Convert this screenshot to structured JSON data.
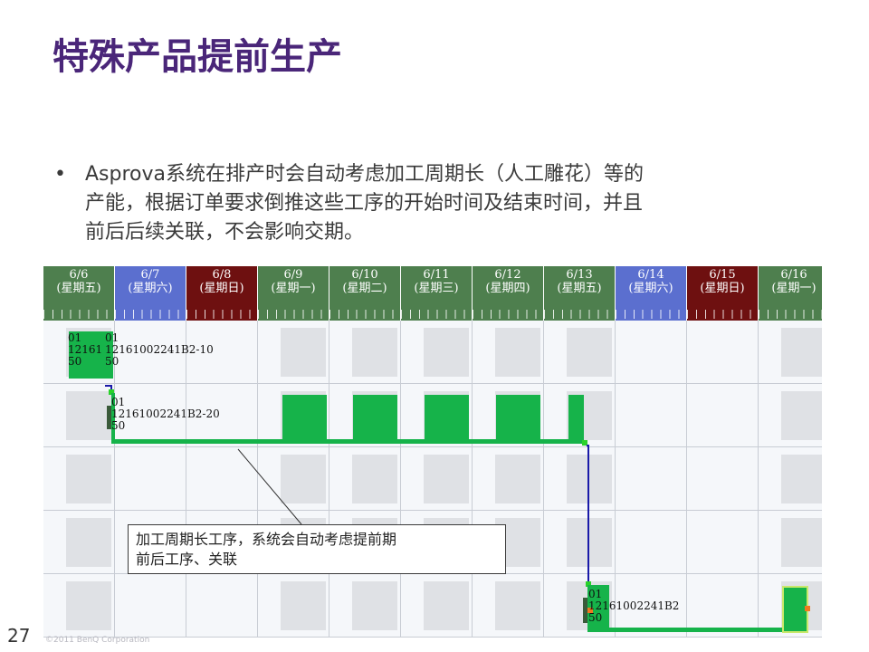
{
  "slide": {
    "title": "特殊产品提前生产",
    "bullet_symbol": "•",
    "bullet_lines": [
      "Asprova系统在排产时会自动考虑加工周期长（人工雕花）等的",
      "产能，根据订单要求倒推这些工序的开始时间及结束时间，并且",
      "前后后续关联，不会影响交期。"
    ],
    "page_number": "27",
    "copyright": "©2011 BenQ Corporation"
  },
  "gantt": {
    "days": [
      {
        "date": "6/6",
        "weekday": "(星期五)",
        "color": "#4e7f4e"
      },
      {
        "date": "6/7",
        "weekday": "(星期六)",
        "color": "#5b6fcf"
      },
      {
        "date": "6/8",
        "weekday": "(星期日)",
        "color": "#6e1010"
      },
      {
        "date": "6/9",
        "weekday": "(星期一)",
        "color": "#4e7f4e"
      },
      {
        "date": "6/10",
        "weekday": "(星期二)",
        "color": "#4e7f4e"
      },
      {
        "date": "6/11",
        "weekday": "(星期三)",
        "color": "#4e7f4e"
      },
      {
        "date": "6/12",
        "weekday": "(星期四)",
        "color": "#4e7f4e"
      },
      {
        "date": "6/13",
        "weekday": "(星期五)",
        "color": "#4e7f4e"
      },
      {
        "date": "6/14",
        "weekday": "(星期六)",
        "color": "#5b6fcf"
      },
      {
        "date": "6/15",
        "weekday": "(星期日)",
        "color": "#6e1010"
      },
      {
        "date": "6/16",
        "weekday": "(星期一)",
        "color": "#4e7f4e"
      }
    ],
    "job_labels": {
      "job1_left": [
        "01",
        "12161",
        "50"
      ],
      "job1_right": [
        "01",
        "12161002241B2-10",
        "50"
      ],
      "job2": [
        "01",
        "12161002241B2-20",
        "50"
      ],
      "job3": [
        "01",
        "12161002241B2",
        "50"
      ]
    },
    "colors": {
      "task_green": "#16b34a",
      "link_blue": "#1a1aa8",
      "marker_orange": "#f07820",
      "marker_green": "#2ad22a"
    },
    "callout_lines": [
      "加工周期长工序，系统会自动考虑提前期",
      "前后工序、关联"
    ]
  }
}
